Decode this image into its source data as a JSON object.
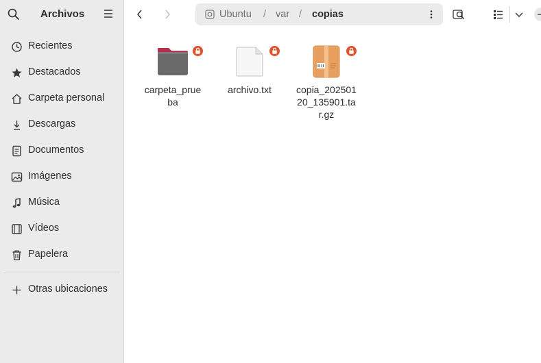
{
  "app": {
    "title": "Archivos"
  },
  "sidebar": {
    "items": [
      {
        "label": "Recientes",
        "icon": "clock-icon"
      },
      {
        "label": "Destacados",
        "icon": "star-icon"
      },
      {
        "label": "Carpeta personal",
        "icon": "home-icon"
      },
      {
        "label": "Descargas",
        "icon": "download-icon"
      },
      {
        "label": "Documentos",
        "icon": "document-icon"
      },
      {
        "label": "Imágenes",
        "icon": "image-icon"
      },
      {
        "label": "Música",
        "icon": "music-icon"
      },
      {
        "label": "Vídeos",
        "icon": "video-icon"
      },
      {
        "label": "Papelera",
        "icon": "trash-icon"
      }
    ],
    "other_locations": "Otras ubicaciones"
  },
  "pathbar": {
    "crumbs": [
      "Ubuntu",
      "var",
      "copias"
    ],
    "separator": "/"
  },
  "files": [
    {
      "name": "carpeta_prueba",
      "type": "folder",
      "locked": true
    },
    {
      "name": "archivo.txt",
      "type": "text",
      "locked": true
    },
    {
      "name": "copia_20250120_135901.tar.gz",
      "type": "archive",
      "locked": true
    }
  ],
  "colors": {
    "sidebar_bg": "#ebebeb",
    "folder": "#6a6a6a",
    "folder_tab": "#b5304f",
    "archive": "#e8a060",
    "lock_badge": "#e0522a"
  }
}
